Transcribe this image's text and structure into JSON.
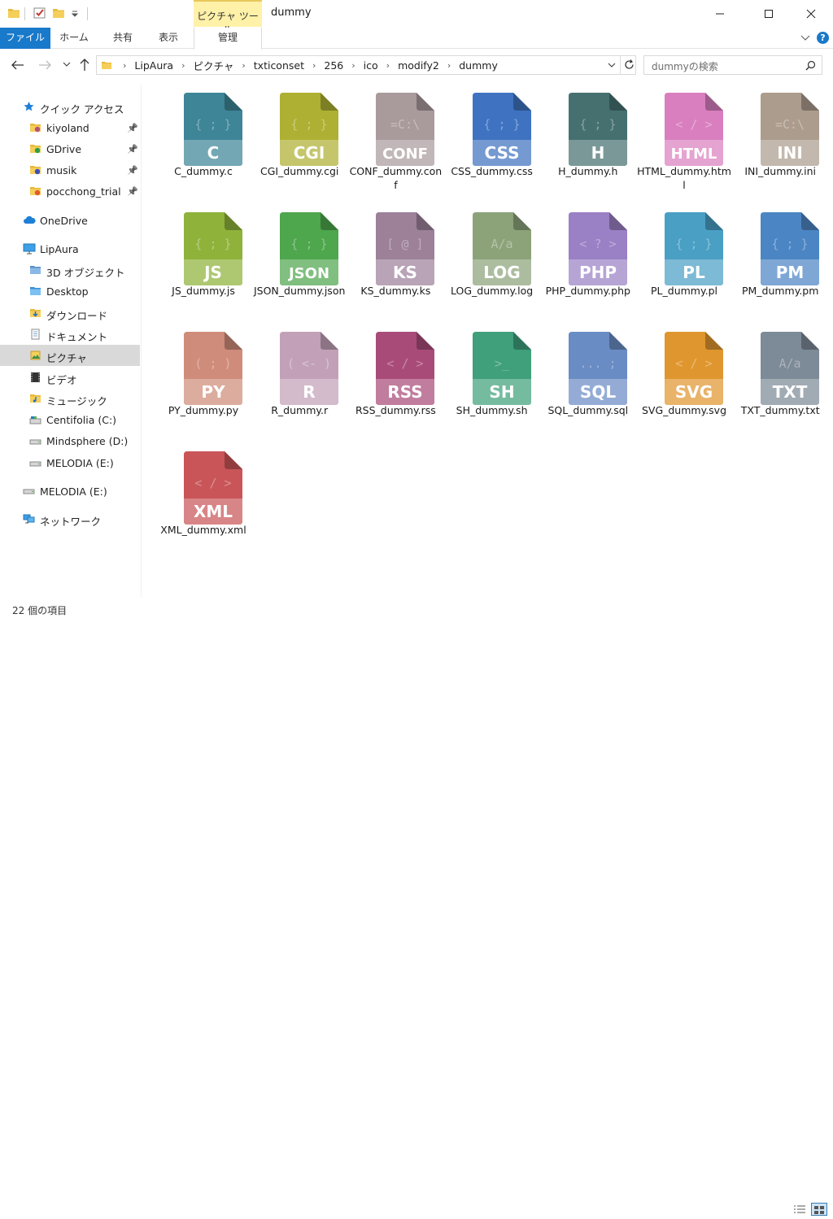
{
  "window": {
    "title": "dummy",
    "contextual_tab": "ピクチャ ツール"
  },
  "ribbon": {
    "tabs": [
      "ファイル",
      "ホーム",
      "共有",
      "表示"
    ],
    "manage": "管理"
  },
  "address": {
    "crumbs": [
      "LipAura",
      "ピクチャ",
      "txticonset",
      "256",
      "ico",
      "modify2",
      "dummy"
    ]
  },
  "search": {
    "placeholder": "dummyの検索"
  },
  "nav": {
    "quick_access": "クイック アクセス",
    "pinned": [
      {
        "label": "kiyoland",
        "icon": "gem-folder-icon",
        "color": "#b8507a"
      },
      {
        "label": "GDrive",
        "icon": "google-drive-icon",
        "color": "#2f9e44"
      },
      {
        "label": "musik",
        "icon": "star-folder-icon",
        "color": "#3b4fb8"
      },
      {
        "label": "pocchong_trial",
        "icon": "ribbon-folder-icon",
        "color": "#e05a2b"
      }
    ],
    "onedrive": "OneDrive",
    "pc": "LipAura",
    "pc_items": [
      {
        "label": "3D オブジェクト",
        "icon": "3d-objects-icon"
      },
      {
        "label": "Desktop",
        "icon": "desktop-folder-icon"
      },
      {
        "label": "ダウンロード",
        "icon": "downloads-icon"
      },
      {
        "label": "ドキュメント",
        "icon": "documents-icon"
      },
      {
        "label": "ピクチャ",
        "icon": "pictures-icon"
      },
      {
        "label": "ビデオ",
        "icon": "videos-icon"
      },
      {
        "label": "ミュージック",
        "icon": "music-icon"
      },
      {
        "label": "Centifolia (C:)",
        "icon": "system-drive-icon"
      },
      {
        "label": "Mindsphere (D:)",
        "icon": "drive-icon"
      },
      {
        "label": "MELODIA (E:)",
        "icon": "removable-drive-icon"
      }
    ],
    "removable": "MELODIA (E:)",
    "network": "ネットワーク"
  },
  "files": [
    {
      "name": "C_dummy.c",
      "ext": "C",
      "sym": "{ ; }",
      "color": "#3d8597"
    },
    {
      "name": "CGI_dummy.cgi",
      "ext": "CGI",
      "sym": "{ ; }",
      "color": "#aeb033"
    },
    {
      "name": "CONF_dummy.conf",
      "ext": "CONF",
      "sym": "=C:\\",
      "color": "#a99a9c"
    },
    {
      "name": "CSS_dummy.css",
      "ext": "CSS",
      "sym": "{ ; }",
      "color": "#3f73c1"
    },
    {
      "name": "H_dummy.h",
      "ext": "H",
      "sym": "{ ; }",
      "color": "#467070"
    },
    {
      "name": "HTML_dummy.html",
      "ext": "HTML",
      "sym": "< / >",
      "color": "#d97fbf"
    },
    {
      "name": "INI_dummy.ini",
      "ext": "INI",
      "sym": "=C:\\",
      "color": "#ac9c8d"
    },
    {
      "name": "JS_dummy.js",
      "ext": "JS",
      "sym": "{ ; }",
      "color": "#8fb23a"
    },
    {
      "name": "JSON_dummy.json",
      "ext": "JSON",
      "sym": "{ ; }",
      "color": "#4ea64d"
    },
    {
      "name": "KS_dummy.ks",
      "ext": "KS",
      "sym": "[ @ ]",
      "color": "#9c8199"
    },
    {
      "name": "LOG_dummy.log",
      "ext": "LOG",
      "sym": "A/a",
      "color": "#8ca37a"
    },
    {
      "name": "PHP_dummy.php",
      "ext": "PHP",
      "sym": "< ? >",
      "color": "#9a80c4"
    },
    {
      "name": "PL_dummy.pl",
      "ext": "PL",
      "sym": "{ ; }",
      "color": "#4a9fc4"
    },
    {
      "name": "PM_dummy.pm",
      "ext": "PM",
      "sym": "{ ; }",
      "color": "#4c85c4"
    },
    {
      "name": "PY_dummy.py",
      "ext": "PY",
      "sym": "( ; )",
      "color": "#cf8c7a"
    },
    {
      "name": "R_dummy.r",
      "ext": "R",
      "sym": "( <- )",
      "color": "#c2a1b8"
    },
    {
      "name": "RSS_dummy.rss",
      "ext": "RSS",
      "sym": "< / >",
      "color": "#a94b78"
    },
    {
      "name": "SH_dummy.sh",
      "ext": "SH",
      "sym": ">_",
      "color": "#3fa07b"
    },
    {
      "name": "SQL_dummy.sql",
      "ext": "SQL",
      "sym": "... ;",
      "color": "#6a8cc4"
    },
    {
      "name": "SVG_dummy.svg",
      "ext": "SVG",
      "sym": "< / >",
      "color": "#e0962e"
    },
    {
      "name": "TXT_dummy.txt",
      "ext": "TXT",
      "sym": "A/a",
      "color": "#7d8a97"
    },
    {
      "name": "XML_dummy.xml",
      "ext": "XML",
      "sym": "< / >",
      "color": "#c95558"
    }
  ],
  "status": {
    "count": "22 個の項目"
  }
}
